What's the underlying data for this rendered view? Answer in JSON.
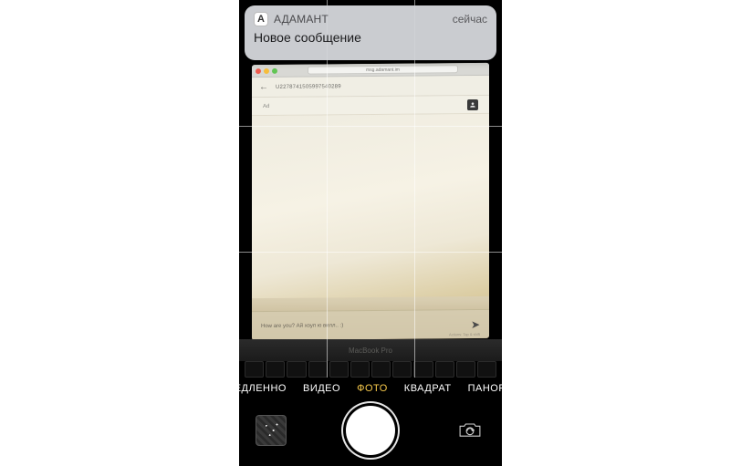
{
  "notification": {
    "icon_letter": "A",
    "app_name": "АДАМАНТ",
    "time": "сейчас",
    "body": "Новое сообщение"
  },
  "scene": {
    "browser": {
      "url_label": "msg.adamant.im"
    },
    "chat": {
      "back_glyph": "←",
      "id": "U2278741505997540289",
      "short_label": "Ad",
      "input_text": "How are you? Ай хоуп ю вилл.. :)",
      "send_glyph": "➤",
      "foot_note": "Actions: Tap & shift"
    },
    "macbook_label": "MacBook Pro"
  },
  "camera": {
    "modes": {
      "slow": "ЕДЛЕННО",
      "video": "ВИДЕО",
      "photo": "ФОТО",
      "square": "КВАДРАТ",
      "pano": "ПАНОРА"
    }
  }
}
